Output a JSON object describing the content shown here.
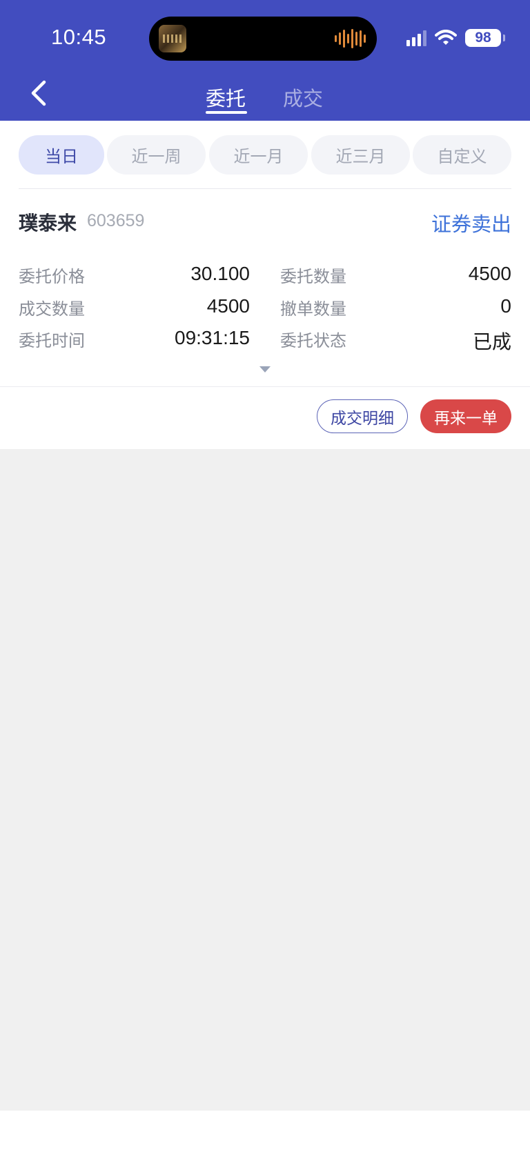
{
  "status_bar": {
    "time": "10:45",
    "battery": "98"
  },
  "nav": {
    "tabs": [
      {
        "label": "委托",
        "active": true
      },
      {
        "label": "成交",
        "active": false
      }
    ]
  },
  "filters": [
    {
      "label": "当日",
      "active": true
    },
    {
      "label": "近一周",
      "active": false
    },
    {
      "label": "近一月",
      "active": false
    },
    {
      "label": "近三月",
      "active": false
    },
    {
      "label": "自定义",
      "active": false
    }
  ],
  "order": {
    "stock_name": "璞泰来",
    "stock_code": "603659",
    "side": "证券卖出",
    "fields": {
      "price_label": "委托价格",
      "price_value": "30.100",
      "qty_label": "委托数量",
      "qty_value": "4500",
      "filled_label": "成交数量",
      "filled_value": "4500",
      "cancel_label": "撤单数量",
      "cancel_value": "0",
      "time_label": "委托时间",
      "time_value": "09:31:15",
      "status_label": "委托状态",
      "status_value": "已成"
    }
  },
  "actions": {
    "detail": "成交明细",
    "reorder": "再来一单"
  },
  "colors": {
    "header": "#424dbf",
    "sell": "#3e72d9",
    "reorder": "#d94848"
  }
}
